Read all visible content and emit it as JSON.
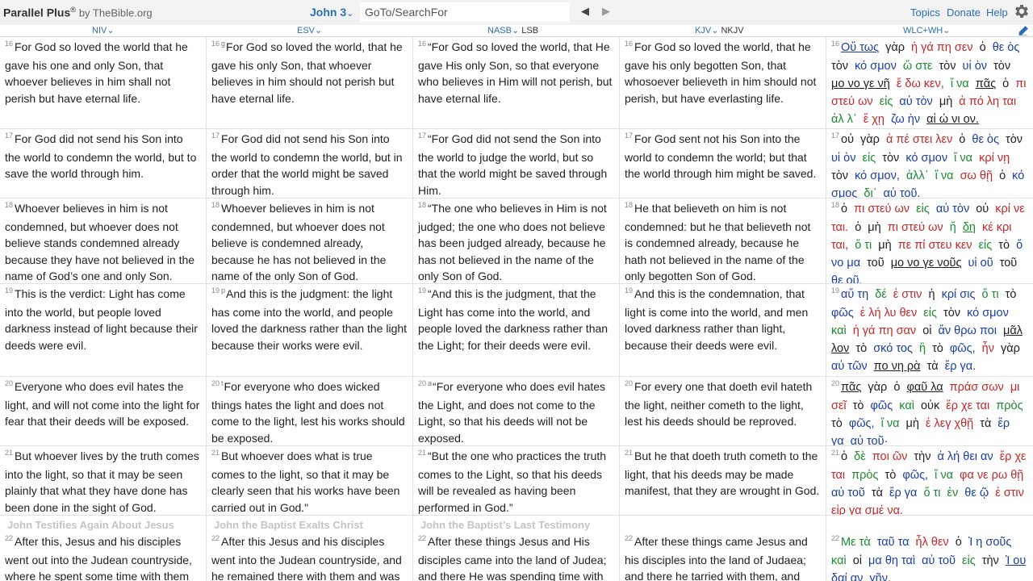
{
  "header": {
    "app_name": "Parallel Plus",
    "app_reg": "®",
    "app_by": "by TheBible.org",
    "book_chapter": "John 3",
    "search_placeholder": "GoTo/SearchFor",
    "prev_glyph": "◀",
    "next_glyph": "▶",
    "nav": {
      "topics": "Topics",
      "donate": "Donate",
      "help": "Help"
    },
    "settings_icon": "gear-icon",
    "edit_icon": "pencil-icon"
  },
  "dropdown_glyph": "⌄",
  "versions": [
    {
      "name": "NIV",
      "alt": ""
    },
    {
      "name": "ESV",
      "alt": ""
    },
    {
      "name": "NASB",
      "alt": "LSB"
    },
    {
      "name": "KJV",
      "alt": "NKJV"
    },
    {
      "name": "WLC+WH",
      "alt": ""
    }
  ],
  "rows": [
    {
      "niv": {
        "v": "16",
        "fn": "",
        "text": "For God so loved the world that he gave his one and only Son, that whoever believes in him shall not perish but have eternal life."
      },
      "esv": {
        "v": "16",
        "fn": "g",
        "text": "For God so loved the world, that he gave his only Son, that whoever believes in him should not perish but have eternal life."
      },
      "nasb": {
        "v": "16",
        "fn": "",
        "text": "“For God so loved the world, that He gave His only Son, so that everyone who believes in Him will not perish, but have eternal life."
      },
      "kjv": {
        "v": "16",
        "fn": "",
        "text": "For God so loved the world, that he gave his only begotten Son, that whosoever believeth in him should not perish, but have everlasting life."
      },
      "wlc": {
        "v": "16",
        "words": [
          {
            "t": "Οὕ τως",
            "c": "b",
            "u": true
          },
          {
            "t": "γὰρ",
            "c": "k"
          },
          {
            "t": "ἠ γά πη σεν",
            "c": "r"
          },
          {
            "t": "ὁ",
            "c": "k"
          },
          {
            "t": "θε ὸς",
            "c": "b"
          },
          {
            "t": "τὸν",
            "c": "k"
          },
          {
            "t": "κό σμον",
            "c": "b"
          },
          {
            "t": "ὥ στε",
            "c": "g"
          },
          {
            "t": "τὸν",
            "c": "k"
          },
          {
            "t": "υἱ ὸν",
            "c": "b"
          },
          {
            "t": "τὸν",
            "c": "k"
          },
          {
            "t": "μο νο γε νῆ",
            "c": "k",
            "u": true
          },
          {
            "t": "ἔ δω κεν,",
            "c": "r"
          },
          {
            "t": "ἵ να",
            "c": "g"
          },
          {
            "t": "πᾶς",
            "c": "k",
            "u": true
          },
          {
            "t": "ὁ",
            "c": "k"
          },
          {
            "t": "πι στεύ ων",
            "c": "r"
          },
          {
            "t": "εἰς",
            "c": "g"
          },
          {
            "t": "αὐ τὸν",
            "c": "b"
          },
          {
            "t": "μὴ",
            "c": "k"
          },
          {
            "t": "ἀ πό λη ται",
            "c": "r"
          },
          {
            "t": "ἀλ λ᾽",
            "c": "g"
          },
          {
            "t": "ἔ χῃ",
            "c": "r"
          },
          {
            "t": "ζω ὴν",
            "c": "b"
          },
          {
            "t": "αἰ ώ νι ον.",
            "c": "k",
            "u": true
          }
        ]
      }
    },
    {
      "niv": {
        "v": "17",
        "fn": "",
        "text": "For God did not send his Son into the world to condemn the world, but to save the world through him."
      },
      "esv": {
        "v": "17",
        "fn": "",
        "text": "For God did not send his Son into the world to condemn the world, but in order that the world might be saved through him."
      },
      "nasb": {
        "v": "17",
        "fn": "",
        "text": "“For God did not send the Son into the world to judge the world, but so that the world might be saved through Him."
      },
      "kjv": {
        "v": "17",
        "fn": "",
        "text": "For God sent not his Son into the world to condemn the world; but that the world through him might be saved."
      },
      "wlc": {
        "v": "17",
        "words": [
          {
            "t": "οὐ",
            "c": "k"
          },
          {
            "t": "γὰρ",
            "c": "k"
          },
          {
            "t": "ἀ πέ στει λεν",
            "c": "r"
          },
          {
            "t": "ὁ",
            "c": "k"
          },
          {
            "t": "θε ὸς",
            "c": "b"
          },
          {
            "t": "τὸν",
            "c": "k"
          },
          {
            "t": "υἱ ὸν",
            "c": "b"
          },
          {
            "t": "εἰς",
            "c": "g"
          },
          {
            "t": "τὸν",
            "c": "k"
          },
          {
            "t": "κό σμον",
            "c": "b"
          },
          {
            "t": "ἵ να",
            "c": "g"
          },
          {
            "t": "κρί νῃ",
            "c": "r"
          },
          {
            "t": "τὸν",
            "c": "k"
          },
          {
            "t": "κό σμον,",
            "c": "b"
          },
          {
            "t": "ἀλλ᾽",
            "c": "g"
          },
          {
            "t": "ἵ να",
            "c": "g"
          },
          {
            "t": "σω θῇ",
            "c": "r"
          },
          {
            "t": "ὁ",
            "c": "k"
          },
          {
            "t": "κό σμος",
            "c": "b"
          },
          {
            "t": "δι᾽",
            "c": "g"
          },
          {
            "t": "αὐ τοῦ.",
            "c": "b"
          }
        ]
      }
    },
    {
      "niv": {
        "v": "18",
        "fn": "",
        "text": "Whoever believes in him is not condemned, but whoever does not believe stands condemned already because they have not believed in the name of God’s one and only Son."
      },
      "esv": {
        "v": "18",
        "fn": "",
        "text": "Whoever believes in him is not condemned, but whoever does not believe is condemned already, because he has not believed in the name of the only Son of God."
      },
      "nasb": {
        "v": "18",
        "fn": "",
        "text": "“The one who believes in Him is not judged; the one who does not believe has been judged already, because he has not believed in the name of the only Son of God."
      },
      "kjv": {
        "v": "18",
        "fn": "",
        "text": "He that believeth on him is not condemned: but he that believeth not is condemned already, because he hath not believed in the name of the only begotten Son of God."
      },
      "wlc": {
        "v": "18",
        "words": [
          {
            "t": "ὁ",
            "c": "k"
          },
          {
            "t": "πι στεύ ων",
            "c": "r"
          },
          {
            "t": "εἰς",
            "c": "g"
          },
          {
            "t": "αὐ τὸν",
            "c": "b"
          },
          {
            "t": "οὐ",
            "c": "k"
          },
          {
            "t": "κρί νε ται.",
            "c": "r"
          },
          {
            "t": "ὁ",
            "c": "k"
          },
          {
            "t": "μὴ",
            "c": "k"
          },
          {
            "t": "πι στεύ ων",
            "c": "r"
          },
          {
            "t": "ἤ",
            "c": "g"
          },
          {
            "t": "δη",
            "c": "g",
            "u": true
          },
          {
            "t": "κέ κρι ται,",
            "c": "r"
          },
          {
            "t": "ὅ τι",
            "c": "g"
          },
          {
            "t": "μὴ",
            "c": "k"
          },
          {
            "t": "πε πί στευ κεν",
            "c": "r"
          },
          {
            "t": "εἰς",
            "c": "g"
          },
          {
            "t": "τὸ",
            "c": "k"
          },
          {
            "t": "ὄ νο μα",
            "c": "b"
          },
          {
            "t": "τοῦ",
            "c": "k"
          },
          {
            "t": "μο νο γε νοῦς",
            "c": "k",
            "u": true
          },
          {
            "t": "υἱ οῦ",
            "c": "b"
          },
          {
            "t": "τοῦ",
            "c": "k"
          },
          {
            "t": "θε οῦ.",
            "c": "b"
          }
        ]
      }
    },
    {
      "niv": {
        "v": "19",
        "fn": "",
        "text": "This is the verdict: Light has come into the world, but people loved darkness instead of light because their deeds were evil."
      },
      "esv": {
        "v": "19",
        "fn": "p",
        "text": "And this is the judgment: the light has come into the world, and people loved the darkness rather than the light because their works were evil."
      },
      "nasb": {
        "v": "19",
        "fn": "",
        "text": "“And this is the judgment, that the Light has come into the world, and people loved the darkness rather than the Light; for their deeds were evil."
      },
      "kjv": {
        "v": "19",
        "fn": "",
        "text": "And this is the condemnation, that light is come into the world, and men loved darkness rather than light, because their deeds were evil."
      },
      "wlc": {
        "v": "19",
        "words": [
          {
            "t": "αὕ τη",
            "c": "b"
          },
          {
            "t": "δέ",
            "c": "g"
          },
          {
            "t": "ἐ στιν",
            "c": "r"
          },
          {
            "t": "ἡ",
            "c": "k"
          },
          {
            "t": "κρί σις",
            "c": "b"
          },
          {
            "t": "ὅ τι",
            "c": "g"
          },
          {
            "t": "τὸ",
            "c": "k"
          },
          {
            "t": "φῶς",
            "c": "b"
          },
          {
            "t": "ἐ λή λυ θεν",
            "c": "r"
          },
          {
            "t": "εἰς",
            "c": "g"
          },
          {
            "t": "τὸν",
            "c": "k"
          },
          {
            "t": "κό σμον",
            "c": "b"
          },
          {
            "t": "καὶ",
            "c": "g"
          },
          {
            "t": "ἠ γά πη σαν",
            "c": "r"
          },
          {
            "t": "οἱ",
            "c": "k"
          },
          {
            "t": "ἄν θρω ποι",
            "c": "b"
          },
          {
            "t": "μᾶλ λον",
            "c": "k",
            "u": true
          },
          {
            "t": "τὸ",
            "c": "k"
          },
          {
            "t": "σκό τος",
            "c": "b"
          },
          {
            "t": "ἢ",
            "c": "g"
          },
          {
            "t": "τὸ",
            "c": "k"
          },
          {
            "t": "φῶς,",
            "c": "b"
          },
          {
            "t": "ἦν",
            "c": "r"
          },
          {
            "t": "γὰρ",
            "c": "k"
          },
          {
            "t": "αὐ τῶν",
            "c": "b"
          },
          {
            "t": "πο νη ρὰ",
            "c": "k",
            "u": true
          },
          {
            "t": "τὰ",
            "c": "k"
          },
          {
            "t": "ἔρ γα.",
            "c": "b"
          }
        ]
      }
    },
    {
      "niv": {
        "v": "20",
        "fn": "",
        "text": "Everyone who does evil hates the light, and will not come into the light for fear that their deeds will be exposed."
      },
      "esv": {
        "v": "20",
        "fn": "t",
        "text": "For everyone who does wicked things hates the light and does not come to the light, lest his works should be exposed."
      },
      "nasb": {
        "v": "20",
        "fn": "a",
        "text": "“For everyone who does evil hates the Light, and does not come to the Light, so that his deeds will not be exposed."
      },
      "kjv": {
        "v": "20",
        "fn": "",
        "text": "For every one that doeth evil hateth the light, neither cometh to the light, lest his deeds should be reproved."
      },
      "wlc": {
        "v": "20",
        "words": [
          {
            "t": "πᾶς",
            "c": "k",
            "u": true
          },
          {
            "t": "γὰρ",
            "c": "k"
          },
          {
            "t": "ὁ",
            "c": "k"
          },
          {
            "t": "φαῦ λα",
            "c": "k",
            "u": true
          },
          {
            "t": "πράσ σων",
            "c": "r"
          },
          {
            "t": "μι σεῖ",
            "c": "r"
          },
          {
            "t": "τὸ",
            "c": "k"
          },
          {
            "t": "φῶς",
            "c": "b"
          },
          {
            "t": "καὶ",
            "c": "g"
          },
          {
            "t": "οὐκ",
            "c": "k"
          },
          {
            "t": "ἔρ χε ται",
            "c": "r"
          },
          {
            "t": "πρὸς",
            "c": "g"
          },
          {
            "t": "τὸ",
            "c": "k"
          },
          {
            "t": "φῶς,",
            "c": "b"
          },
          {
            "t": "ἵ να",
            "c": "g"
          },
          {
            "t": "μὴ",
            "c": "k"
          },
          {
            "t": "ἐ λεγ χθῇ",
            "c": "r"
          },
          {
            "t": "τὰ",
            "c": "k"
          },
          {
            "t": "ἔρ γα",
            "c": "b"
          },
          {
            "t": "αὐ τοῦ·",
            "c": "b"
          }
        ]
      }
    },
    {
      "niv": {
        "v": "21",
        "fn": "",
        "text": "But whoever lives by the truth comes into the light, so that it may be seen plainly that what they have done has been done in the sight of God."
      },
      "esv": {
        "v": "21",
        "fn": "",
        "text": "But whoever does what is true comes to the light, so that it may be clearly seen that his works have been carried out in God.\""
      },
      "nasb": {
        "v": "21",
        "fn": "",
        "text": "“But the one who practices the truth comes to the Light, so that his deeds will be revealed as having been performed in God.”"
      },
      "kjv": {
        "v": "21",
        "fn": "",
        "text": "But he that doeth truth cometh to the light, that his deeds may be made manifest, that they are wrought in God."
      },
      "wlc": {
        "v": "21",
        "words": [
          {
            "t": "ὁ",
            "c": "k"
          },
          {
            "t": "δὲ",
            "c": "g"
          },
          {
            "t": "ποι ῶν",
            "c": "r"
          },
          {
            "t": "τὴν",
            "c": "k"
          },
          {
            "t": "ἀ λή θει αν",
            "c": "b"
          },
          {
            "t": "ἔρ χε ται",
            "c": "r"
          },
          {
            "t": "πρὸς",
            "c": "g"
          },
          {
            "t": "τὸ",
            "c": "k"
          },
          {
            "t": "φῶς,",
            "c": "b"
          },
          {
            "t": "ἵ να",
            "c": "g"
          },
          {
            "t": "φα νε ρω θῇ",
            "c": "r"
          },
          {
            "t": "αὐ τοῦ",
            "c": "b"
          },
          {
            "t": "τὰ",
            "c": "k"
          },
          {
            "t": "ἔρ γα",
            "c": "b"
          },
          {
            "t": "ὅ τι",
            "c": "g"
          },
          {
            "t": "ἐν",
            "c": "g"
          },
          {
            "t": "θε ῷ",
            "c": "b"
          },
          {
            "t": "ἐ στιν",
            "c": "r"
          },
          {
            "t": "εἰρ γα σμέ να.",
            "c": "r"
          }
        ]
      }
    },
    {
      "niv": {
        "heading": "John Testifies Again About Jesus",
        "v": "22",
        "fn": "",
        "text": "After this, Jesus and his disciples went out into the Judean countryside, where he spent some time with them"
      },
      "esv": {
        "heading": "John the Baptist Exalts Christ",
        "v": "22",
        "fn": "",
        "text": "After this Jesus and his disciples went into the Judean countryside, and he remained there with them and was"
      },
      "nasb": {
        "heading": "John the Baptist’s Last Testimony",
        "v": "22",
        "fn": "",
        "text": "After these things Jesus and His disciples came into the land of Judea; and there He was spending time with"
      },
      "kjv": {
        "heading": "",
        "v": "22",
        "fn": "",
        "text": "After these things came Jesus and his disciples into the land of Judaea; and there he tarried with them, and"
      },
      "wlc": {
        "v": "22",
        "words": [
          {
            "t": "Με τὰ",
            "c": "g"
          },
          {
            "t": "ταῦ τα",
            "c": "b"
          },
          {
            "t": "ἦλ θεν",
            "c": "r"
          },
          {
            "t": "ὁ",
            "c": "k"
          },
          {
            "t": "Ἰ η σοῦς",
            "c": "b"
          },
          {
            "t": "καὶ",
            "c": "g"
          },
          {
            "t": "οἱ",
            "c": "k"
          },
          {
            "t": "μα θη ταὶ",
            "c": "b"
          },
          {
            "t": "αὐ τοῦ",
            "c": "b"
          },
          {
            "t": "εἰς",
            "c": "g"
          },
          {
            "t": "τὴν",
            "c": "k"
          },
          {
            "t": "Ἰ ου δαί αν",
            "c": "b",
            "u": true
          },
          {
            "t": "γῆν,",
            "c": "b"
          }
        ]
      }
    }
  ]
}
